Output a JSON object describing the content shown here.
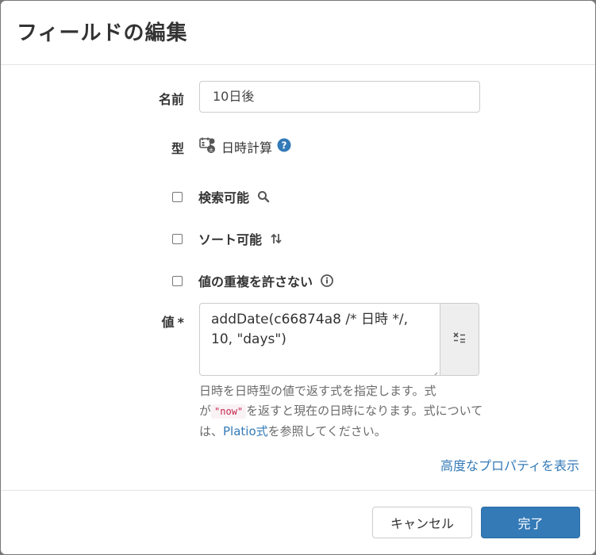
{
  "dialog": {
    "title": "フィールドの編集"
  },
  "fields": {
    "name_label": "名前",
    "name_value": "10日後",
    "type_label": "型",
    "type_value": "日時計算",
    "searchable_label": "検索可能",
    "sortable_label": "ソート可能",
    "unique_label": "値の重複を許さない",
    "value_label": "値",
    "required_mark": "*",
    "formula_line1": "addDate(c66874a8 /* 日時 */,",
    "formula_line2": "10, \"days\")"
  },
  "help": {
    "part1": "日時を日時型の値で返す式を指定します。式が",
    "code": "\"now\"",
    "part2": "を返すと現在の日時になります。式については、",
    "link": "Platio式",
    "part3": "を参照してください。"
  },
  "advanced_link": "高度なプロパティを表示",
  "footer": {
    "cancel_label": "キャンセル",
    "done_label": "完了"
  },
  "colors": {
    "primary": "#337ab7",
    "link": "#337ab7",
    "code": "#c7254e"
  },
  "icons": [
    "datetime-calc-icon",
    "help-icon",
    "search-icon",
    "sort-icon",
    "info-icon",
    "formula-editor-icon"
  ]
}
